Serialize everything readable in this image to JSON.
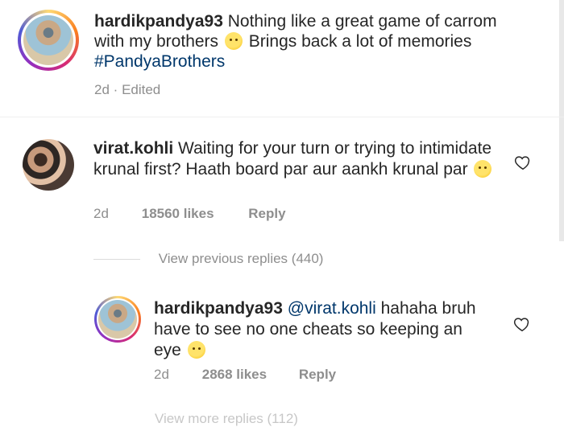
{
  "caption": {
    "username": "hardikpandya93",
    "text_before_emoji": "Nothing like a great game of carrom with my brothers",
    "emoji": "hugging-face",
    "text_after_emoji": "Brings back a lot of memories",
    "hashtag": "#PandyaBrothers",
    "time": "2d",
    "separator": "·",
    "edited": "Edited"
  },
  "comment": {
    "username": "virat.kohli",
    "text": "Waiting for your turn or trying to intimidate krunal first? Haath board par aur aankh krunal par",
    "emoji": "face-with-tears-of-joy",
    "time": "2d",
    "likes": "18560 likes",
    "reply_label": "Reply",
    "heart_icon": "heart-outline"
  },
  "view_previous_replies": "View previous replies (440)",
  "reply": {
    "username": "hardikpandya93",
    "mention": "@virat.kohli",
    "text": "hahaha bruh have to see no one cheats so keeping an eye",
    "emoji": "winking-face",
    "time": "2d",
    "likes": "2868 likes",
    "reply_label": "Reply",
    "heart_icon": "heart-outline"
  },
  "bottom_partial": "View more replies (112)",
  "colors": {
    "text": "#262626",
    "muted": "#8e8e8e",
    "hashtag": "#00376b",
    "divider": "#efefef"
  }
}
